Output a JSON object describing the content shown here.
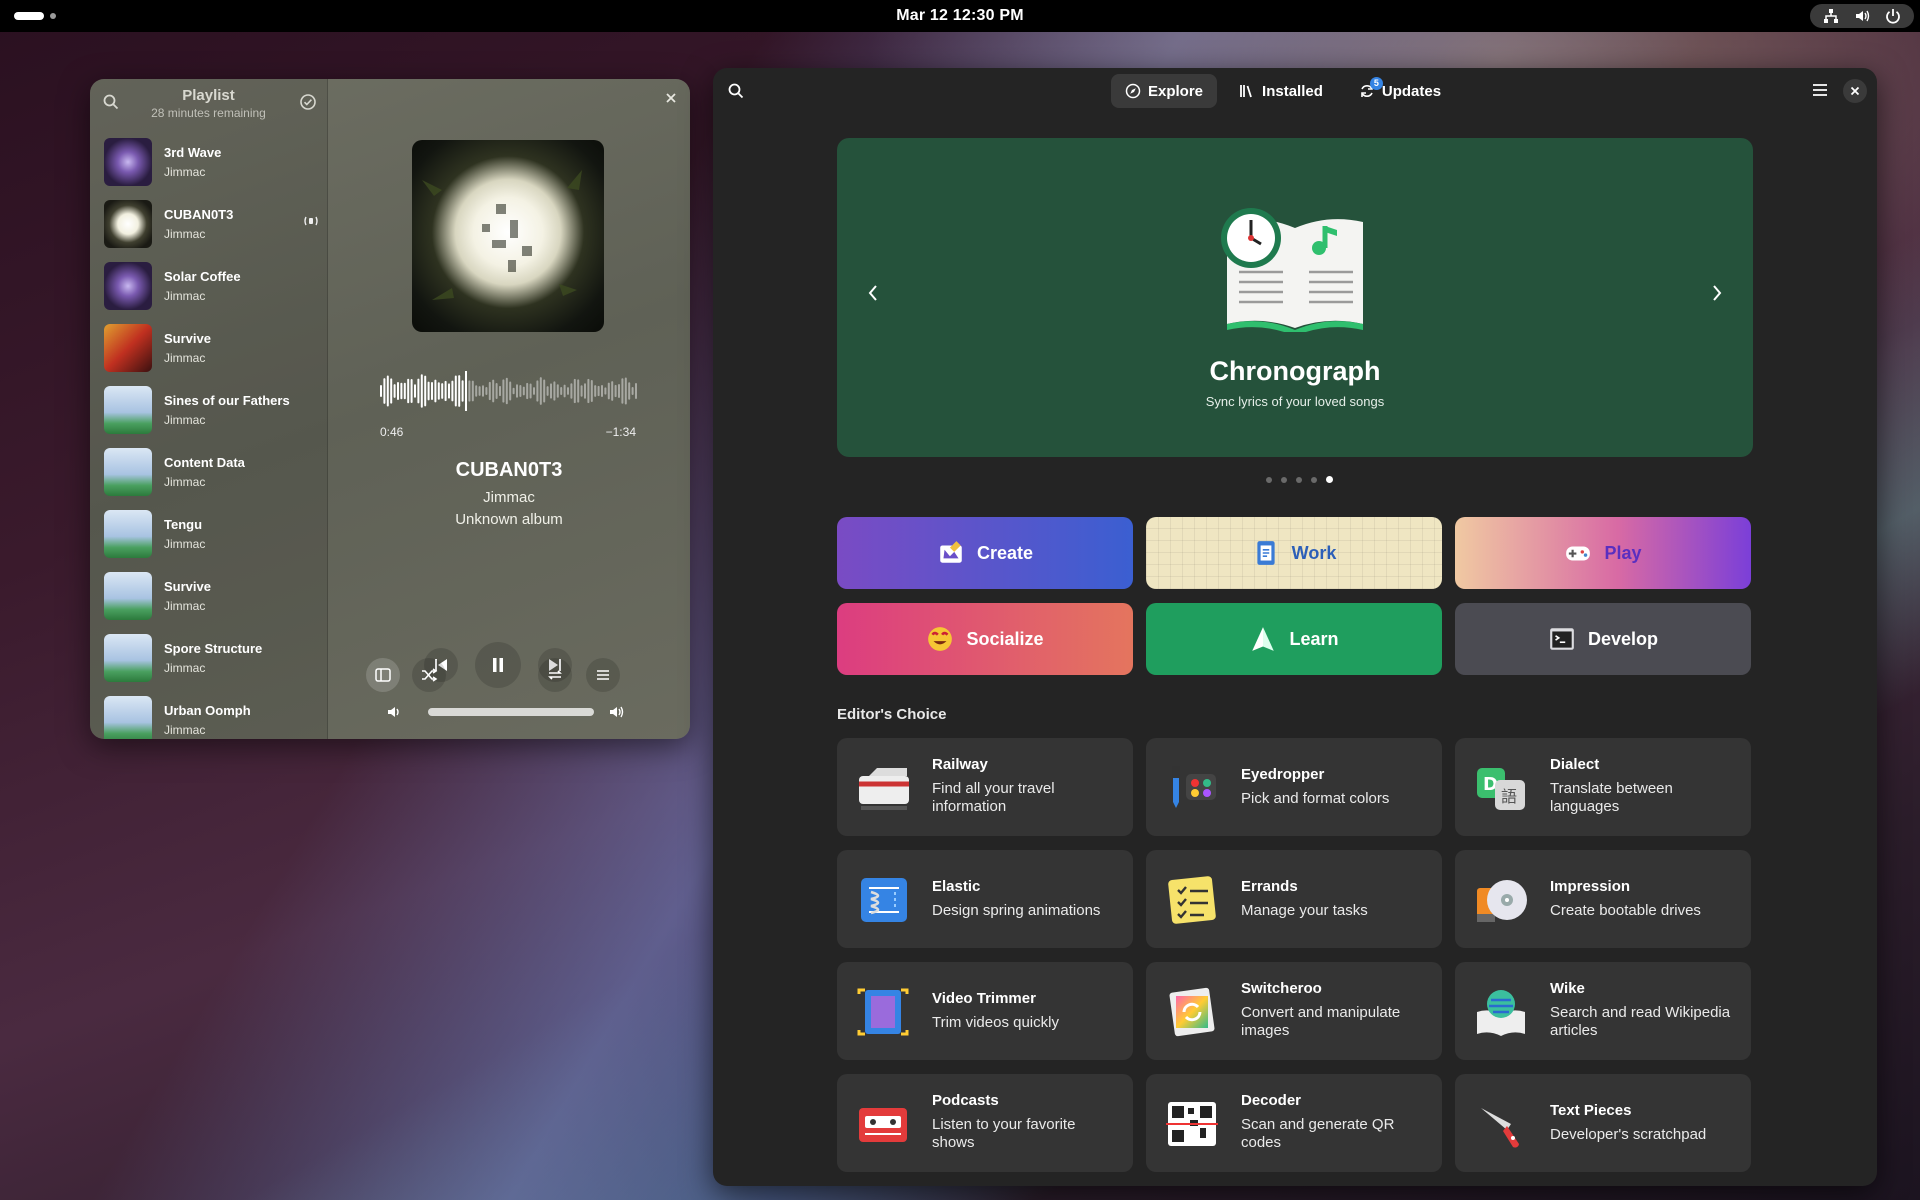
{
  "topbar": {
    "clock": "Mar 12  12:30 PM",
    "tray_icons": [
      "network-icon",
      "volume-icon",
      "power-icon"
    ]
  },
  "music": {
    "playlist_title": "Playlist",
    "playlist_remaining": "28 minutes remaining",
    "tracks": [
      {
        "title": "3rd Wave",
        "artist": "Jimmac",
        "art": "purple"
      },
      {
        "title": "CUBAN0T3",
        "artist": "Jimmac",
        "art": "white",
        "playing": true
      },
      {
        "title": "Solar Coffee",
        "artist": "Jimmac",
        "art": "purple"
      },
      {
        "title": "Survive",
        "artist": "Jimmac",
        "art": "dragon"
      },
      {
        "title": "Sines of our Fathers",
        "artist": "Jimmac",
        "art": "sky"
      },
      {
        "title": "Content Data",
        "artist": "Jimmac",
        "art": "sky"
      },
      {
        "title": "Tengu",
        "artist": "Jimmac",
        "art": "sky"
      },
      {
        "title": "Survive",
        "artist": "Jimmac",
        "art": "sky"
      },
      {
        "title": "Spore Structure",
        "artist": "Jimmac",
        "art": "sky"
      },
      {
        "title": "Urban Oomph",
        "artist": "Jimmac",
        "art": "sky"
      }
    ],
    "now_playing": {
      "title": "CUBAN0T3",
      "artist": "Jimmac",
      "album": "Unknown album",
      "elapsed": "0:46",
      "remaining": "−1:34",
      "progress": 0.33,
      "volume": 1.0
    }
  },
  "software": {
    "tabs": [
      {
        "label": "Explore",
        "icon": "compass-icon",
        "active": true
      },
      {
        "label": "Installed",
        "icon": "library-icon"
      },
      {
        "label": "Updates",
        "icon": "refresh-icon",
        "badge": "5"
      }
    ],
    "banner": {
      "title": "Chronograph",
      "subtitle": "Sync lyrics of your loved songs",
      "dots": 5,
      "active_dot": 5,
      "color": "#25523b"
    },
    "categories": [
      {
        "label": "Create",
        "icon": "create-icon",
        "bg": "linear-gradient(90deg,#7a4bc4,#3b5fd1)"
      },
      {
        "label": "Work",
        "icon": "work-icon",
        "bg": "#efe6c2",
        "color": "#2c5fb8"
      },
      {
        "label": "Play",
        "icon": "gamepad-icon",
        "bg": "linear-gradient(90deg,#f0c9a2,#d86aa4 55%,#7b3fd8)",
        "color": "#5a2fc0"
      },
      {
        "label": "Socialize",
        "icon": "smiley-icon",
        "bg": "linear-gradient(90deg,#dc3d80,#e4755e)"
      },
      {
        "label": "Learn",
        "icon": "learn-icon",
        "bg": "#1f9e5e"
      },
      {
        "label": "Develop",
        "icon": "terminal-icon",
        "bg": "#4b4b52"
      }
    ],
    "editors_choice_title": "Editor's Choice",
    "apps": [
      {
        "name": "Railway",
        "desc": "Find all your travel information",
        "icon": "train-icon"
      },
      {
        "name": "Eyedropper",
        "desc": "Pick and format colors",
        "icon": "eyedropper-icon"
      },
      {
        "name": "Dialect",
        "desc": "Translate between languages",
        "icon": "translate-icon"
      },
      {
        "name": "Elastic",
        "desc": "Design spring animations",
        "icon": "spring-icon"
      },
      {
        "name": "Errands",
        "desc": "Manage your tasks",
        "icon": "checklist-icon"
      },
      {
        "name": "Impression",
        "desc": "Create bootable drives",
        "icon": "disc-icon"
      },
      {
        "name": "Video Trimmer",
        "desc": "Trim videos quickly",
        "icon": "film-icon"
      },
      {
        "name": "Switcheroo",
        "desc": "Convert and manipulate images",
        "icon": "convert-icon"
      },
      {
        "name": "Wike",
        "desc": "Search and read Wikipedia articles",
        "icon": "wiki-icon"
      },
      {
        "name": "Podcasts",
        "desc": "Listen to your favorite shows",
        "icon": "podcast-icon"
      },
      {
        "name": "Decoder",
        "desc": "Scan and generate QR codes",
        "icon": "qr-icon"
      },
      {
        "name": "Text Pieces",
        "desc": "Developer's scratchpad",
        "icon": "knife-icon"
      }
    ]
  }
}
